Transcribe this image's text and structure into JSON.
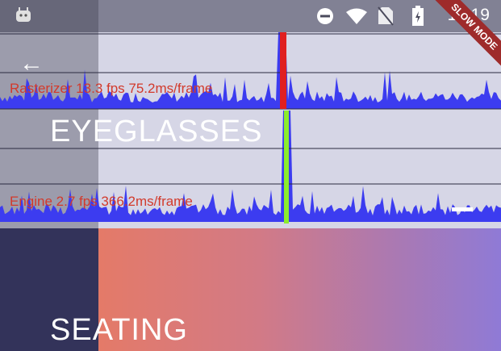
{
  "status_bar": {
    "time": "10:19"
  },
  "categories": [
    {
      "title": "EYEGLASSES"
    },
    {
      "title": "SEATING"
    }
  ],
  "performance_overlay": {
    "rasterizer_label": "Rasterizer  13.3 fps  75.2ms/frame",
    "engine_label": "Engine  2.7 fps  366.2ms/frame",
    "colors": {
      "bar": "#3c3cf0",
      "rasterizer_marker": "#e02020",
      "engine_marker": "#8cec2c",
      "label": "#d23a2c"
    }
  },
  "banner": {
    "text": "SLOW MODE"
  },
  "icons": {
    "back": "back-arrow-icon",
    "android": "android-icon",
    "do_not_disturb": "do-not-disturb-icon",
    "wifi": "wifi-icon",
    "no_sim": "no-sim-icon",
    "battery": "battery-icon"
  }
}
